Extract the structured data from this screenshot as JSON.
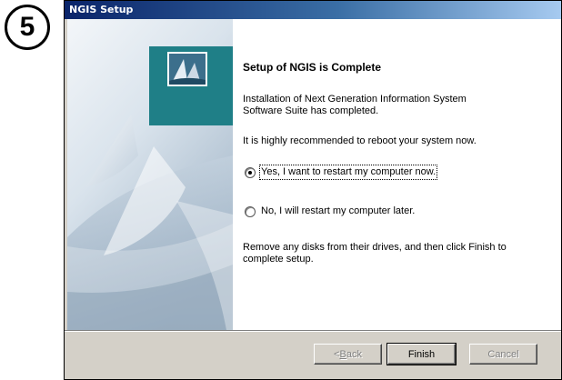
{
  "step_badge": "5",
  "window": {
    "title": "NGIS Setup"
  },
  "content": {
    "heading": "Setup of NGIS is Complete",
    "paragraph1_line1": "Installation of Next Generation Information System",
    "paragraph1_line2": "Software Suite has completed.",
    "paragraph2": "It is highly recommended to reboot your system now.",
    "restart_options": [
      {
        "label": "Yes, I want to restart my computer now.",
        "selected": true
      },
      {
        "label": "No, I will restart my computer later.",
        "selected": false
      }
    ],
    "paragraph3_line1": "Remove any disks from their drives, and then click Finish to",
    "paragraph3_line2": "complete setup."
  },
  "buttons": {
    "back_prefix": "< ",
    "back_mnemonic": "B",
    "back_rest": "ack",
    "finish": "Finish",
    "cancel": "Cancel"
  },
  "colors": {
    "title_gradient_start": "#0a246a",
    "title_gradient_end": "#a6caf0",
    "teal_block": "#1f7f87",
    "dialog_face": "#d4d0c8"
  },
  "icons": {
    "logo": "sail-logo-icon",
    "decoration": "sail-watermark-icon"
  }
}
